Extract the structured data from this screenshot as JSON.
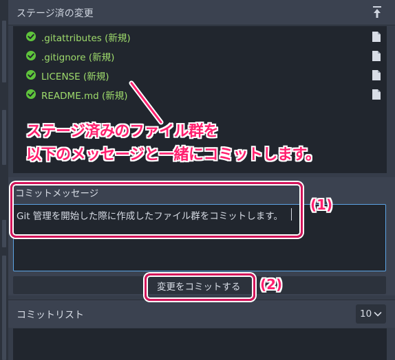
{
  "staged": {
    "title": "ステージ済の変更",
    "files": [
      {
        "name": ".gitattributes (新規)"
      },
      {
        "name": ".gitignore (新規)"
      },
      {
        "name": "LICENSE (新規)"
      },
      {
        "name": "README.md (新規)"
      }
    ]
  },
  "annotation": {
    "line1": "ステージ済みのファイル群を",
    "line2": "以下のメッセージと一緒にコミットします。",
    "marker1": "(1)",
    "marker2": "(2)"
  },
  "commit": {
    "label": "コミットメッセージ",
    "message": "Git 管理を開始した際に作成したファイル群をコミットします。",
    "button": "変更をコミットする"
  },
  "commit_list": {
    "title": "コミットリスト",
    "count": "10"
  },
  "colors": {
    "accent": "#5da5e6",
    "staged_text": "#9fdc6c",
    "annotation": "#ff1f6e",
    "highlight_border": "#d4145a"
  }
}
